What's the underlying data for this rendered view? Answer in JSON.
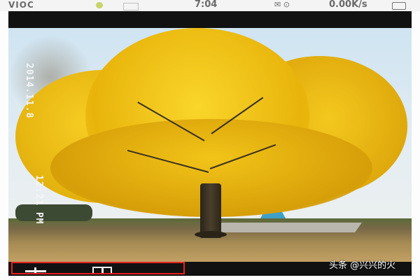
{
  "status_bar": {
    "carrier_left": "VIOC",
    "time": "7:04",
    "network_speed": "0.00K/s"
  },
  "photo": {
    "date_stamp": "2014.11.8",
    "time_stamp": "12:21 PM"
  },
  "overlay": {
    "source_tag": "头条 @兴兴的火"
  },
  "colors": {
    "highlight_border": "#e82020",
    "foliage": "#f2c418",
    "bar_black": "#111111"
  }
}
